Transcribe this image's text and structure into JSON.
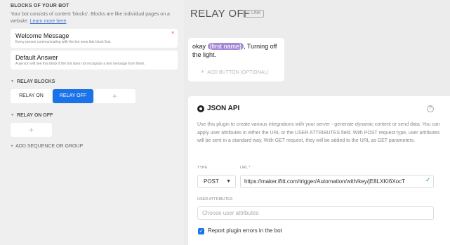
{
  "left": {
    "heading": "BLOCKS OF YOUR BOT",
    "description": "Your bot consists of content 'blocks'. Blocks are like individual pages on a website.",
    "learn_more": "Learn more here",
    "cards": [
      {
        "title": "Welcome Message",
        "subtitle": "Every person communicating with the bot sees this block first."
      },
      {
        "title": "Default Answer",
        "subtitle": "A person will see this block if the bot does not recognize a text message from them."
      }
    ],
    "groups": [
      {
        "label": "RELAY BLOCKS",
        "blocks": [
          "RELAY ON",
          "RELAY OFF"
        ]
      },
      {
        "label": "RELAY ON OFF",
        "blocks": []
      }
    ],
    "add_plus": "+",
    "add_sequence": "ADD SEQUENCE OR GROUP"
  },
  "block": {
    "title": "RELAY OFF",
    "link_badge": "LINK"
  },
  "text_card": {
    "prefix": "okay",
    "attribute": "{first name}",
    "suffix": ", Turning off the light.",
    "add_button": "ADD BUTTON (OPTIONAL)"
  },
  "json_api": {
    "title": "JSON API",
    "description": "Use this plugin to create various integrations with your server - generate dynamic content or send data. You can apply user attributes in either the URL or the USER ATTRIBUTES field. With POST request type, user attributes will be sent in a standard way. With GET request, they will be added to the URL as GET parameters.",
    "type_label": "TYPE",
    "type_value": "POST",
    "url_label": "URL *",
    "url_value": "https://maker.ifttt.com/trigger/Automation/with/key/jE8LXKI6XocT",
    "user_attributes_label": "USER ATTRIBUTES",
    "user_attributes_placeholder": "Choose user attributes",
    "report_errors_label": "Report plugin errors in the bot",
    "report_errors_checked": true
  },
  "colors": {
    "accent": "#1a73e8",
    "attribute_chip": "#a389d4",
    "required": "#e53935",
    "valid": "#2e9e4f"
  },
  "icons": {
    "help": "help-circle-icon",
    "json": "json-plugin-icon",
    "link": "link-icon",
    "check": "checkmark-icon",
    "caret": "chevron-down-icon",
    "triangle": "triangle-down-icon"
  }
}
